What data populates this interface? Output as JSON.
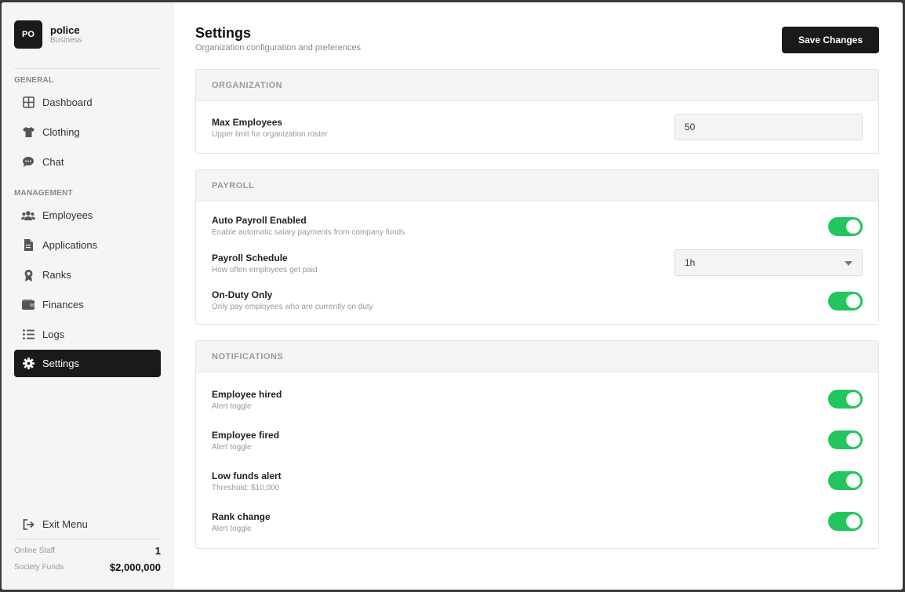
{
  "brand": {
    "initials": "PO",
    "name": "police",
    "type": "Business"
  },
  "sidebar": {
    "sections": [
      {
        "label": "GENERAL"
      },
      {
        "label": "MANAGEMENT"
      }
    ],
    "items": [
      {
        "label": "Dashboard",
        "icon": "dashboard-icon"
      },
      {
        "label": "Clothing",
        "icon": "shirt-icon"
      },
      {
        "label": "Chat",
        "icon": "chat-icon"
      },
      {
        "label": "Employees",
        "icon": "users-icon"
      },
      {
        "label": "Applications",
        "icon": "document-icon"
      },
      {
        "label": "Ranks",
        "icon": "award-icon"
      },
      {
        "label": "Finances",
        "icon": "wallet-icon"
      },
      {
        "label": "Logs",
        "icon": "list-icon"
      },
      {
        "label": "Settings",
        "icon": "gear-icon",
        "active": true
      }
    ],
    "exit_label": "Exit Menu",
    "stats": [
      {
        "label": "Online Staff",
        "value": "1"
      },
      {
        "label": "Society Funds",
        "value": "$2,000,000"
      }
    ]
  },
  "header": {
    "title": "Settings",
    "subtitle": "Organization configuration and preferences",
    "save_label": "Save Changes"
  },
  "organization": {
    "heading": "ORGANIZATION",
    "max_employees": {
      "label": "Max Employees",
      "desc": "Upper limit for organization roster",
      "value": "50"
    }
  },
  "payroll": {
    "heading": "PAYROLL",
    "auto": {
      "label": "Auto Payroll Enabled",
      "desc": "Enable automatic salary payments from company funds",
      "on": true
    },
    "schedule": {
      "label": "Payroll Schedule",
      "desc": "How often employees get paid",
      "value": "1h"
    },
    "on_duty": {
      "label": "On-Duty Only",
      "desc": "Only pay employees who are currently on duty",
      "on": true
    }
  },
  "notifications": {
    "heading": "NOTIFICATIONS",
    "items": [
      {
        "label": "Employee hired",
        "desc": "Alert toggle",
        "on": true
      },
      {
        "label": "Employee fired",
        "desc": "Alert toggle",
        "on": true
      },
      {
        "label": "Low funds alert",
        "desc": "Threshold: $10,000",
        "on": true
      },
      {
        "label": "Rank change",
        "desc": "Alert toggle",
        "on": true
      }
    ]
  },
  "colors": {
    "accent": "#1a1a1a",
    "toggle_on": "#22c55e"
  }
}
